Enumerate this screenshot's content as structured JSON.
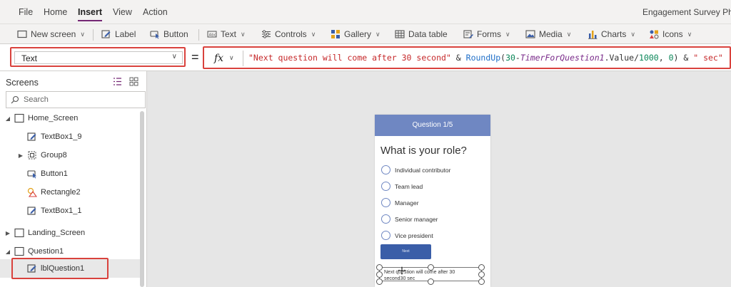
{
  "menu": {
    "items": [
      "File",
      "Home",
      "Insert",
      "View",
      "Action"
    ],
    "active": "Insert",
    "app_title": "Engagement Survey Pho"
  },
  "ribbon": {
    "new_screen": "New screen",
    "label": "Label",
    "button": "Button",
    "text": "Text",
    "controls": "Controls",
    "gallery": "Gallery",
    "data_table": "Data table",
    "forms": "Forms",
    "media": "Media",
    "charts": "Charts",
    "icons": "Icons"
  },
  "formula": {
    "property": "Text",
    "eq": "=",
    "fx": "fx",
    "tokens": {
      "s1": "\"Next question will come after 30 second\"",
      "op1": " & ",
      "fn1": "RoundUp",
      "p1": "(",
      "n1": "30",
      "op2": "-",
      "ctl": "TimerForQuestion1",
      "prop": ".Value/",
      "n2": "1000",
      "p2": ", ",
      "n3": "0",
      "p3": ") & ",
      "s2": "\" sec\""
    }
  },
  "panel": {
    "title": "Screens",
    "search_placeholder": "Search",
    "tree": [
      {
        "label": "Home_Screen"
      },
      {
        "label": "TextBox1_9"
      },
      {
        "label": "Group8"
      },
      {
        "label": "Button1"
      },
      {
        "label": "Rectangle2"
      },
      {
        "label": "TextBox1_1"
      },
      {
        "label": "Landing_Screen"
      },
      {
        "label": "Question1"
      },
      {
        "label": "lblQuestion1"
      }
    ]
  },
  "phone": {
    "header": "Question 1/5",
    "question": "What is your role?",
    "options": [
      "Individual contributor",
      "Team lead",
      "Manager",
      "Senior manager",
      "Vice president"
    ],
    "button_label": "Next",
    "label_text": "Next question will come after 30 second30 sec"
  },
  "colors": {
    "accent": "#742774",
    "highlight": "#d9423d",
    "phone_header": "#6f87c2",
    "button": "#3a5ea8"
  }
}
